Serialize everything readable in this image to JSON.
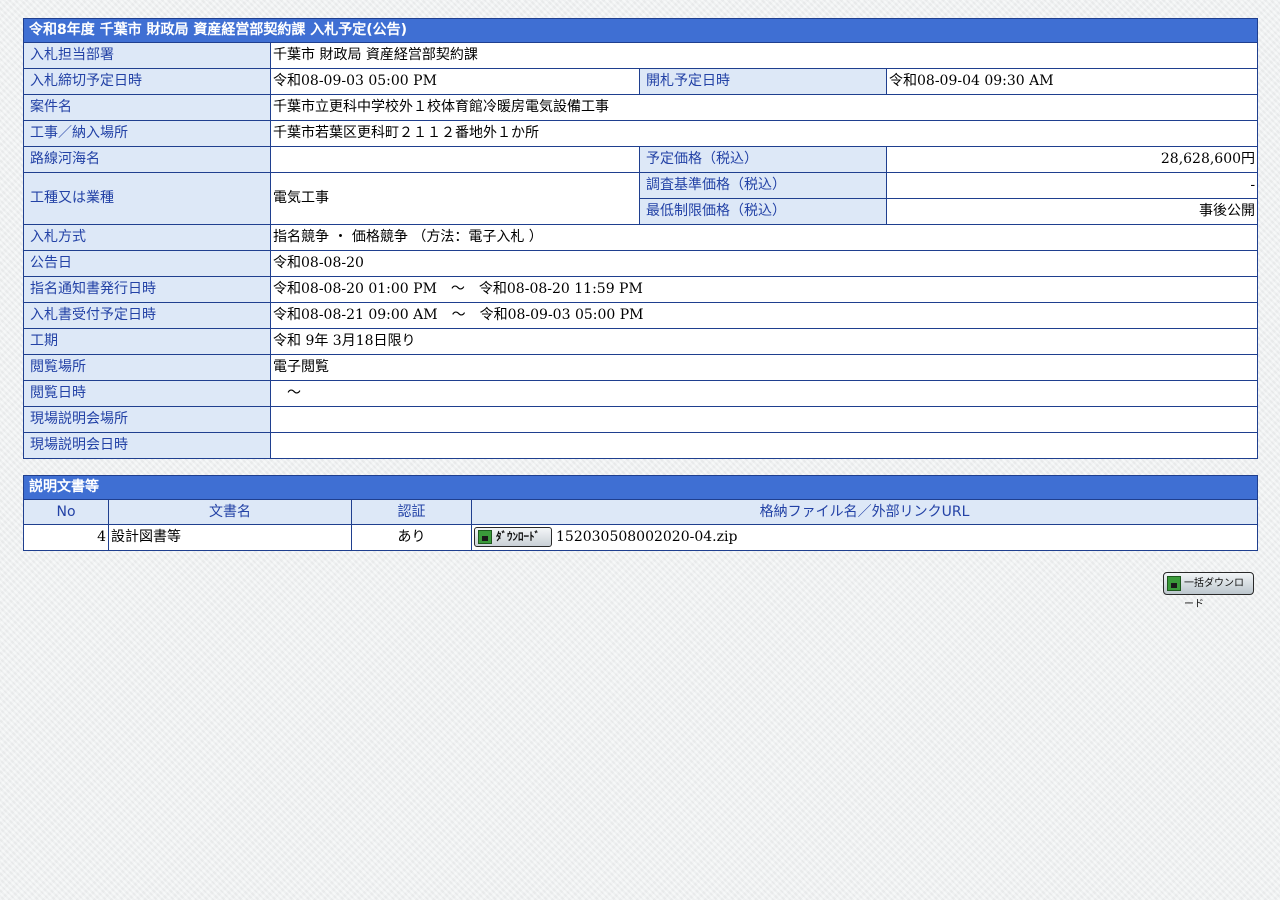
{
  "notice": {
    "title": "令和8年度 千葉市 財政局 資産経営部契約課 入札予定(公告)",
    "rows": {
      "dept": {
        "label": "入札担当部署",
        "value": "千葉市 財政局 資産経営部契約課"
      },
      "deadline": {
        "label": "入札締切予定日時",
        "value": "令和08-09-03 05:00 PM"
      },
      "opening": {
        "label": "開札予定日時",
        "value": "令和08-09-04 09:30 AM"
      },
      "case_name": {
        "label": "案件名",
        "value": "千葉市立更科中学校外１校体育館冷暖房電気設備工事"
      },
      "location": {
        "label": "工事／納入場所",
        "value": "千葉市若葉区更科町２１１２番地外１か所"
      },
      "route": {
        "label": "路線河海名",
        "value": ""
      },
      "planned_price": {
        "label": "予定価格（税込）",
        "value": "28,628,600円"
      },
      "work_type": {
        "label": "工種又は業種",
        "value": "電気工事"
      },
      "survey_price": {
        "label": "調査基準価格（税込）",
        "value": "-"
      },
      "min_price": {
        "label": "最低制限価格（税込）",
        "value": "事後公開"
      },
      "method": {
        "label": "入札方式",
        "value": "指名競争 ・ 価格競争 （方法：電子入札 ）"
      },
      "announce_date": {
        "label": "公告日",
        "value": "令和08-08-20"
      },
      "notify": {
        "label": "指名通知書発行日時",
        "value": "令和08-08-20 01:00 PM　～　令和08-08-20 11:59 PM"
      },
      "reception": {
        "label": "入札書受付予定日時",
        "value": "令和08-08-21 09:00 AM　～　令和08-09-03 05:00 PM"
      },
      "period": {
        "label": "工期",
        "value": "令和 9年 3月18日限り"
      },
      "view_place": {
        "label": "閲覧場所",
        "value": "電子閲覧"
      },
      "view_date": {
        "label": "閲覧日時",
        "value": "　～"
      },
      "briefing_place": {
        "label": "現場説明会場所",
        "value": ""
      },
      "briefing_date": {
        "label": "現場説明会日時",
        "value": ""
      }
    }
  },
  "documents": {
    "title": "説明文書等",
    "headers": {
      "no": "No",
      "name": "文書名",
      "auth": "認証",
      "file": "格納ファイル名／外部リンクURL"
    },
    "rows": [
      {
        "no": "4",
        "name": "設計図書等",
        "auth": "あり",
        "button": "ﾀﾞｳﾝﾛｰﾄﾞ",
        "file": "152030508002020-04.zip"
      }
    ]
  },
  "bulk_download": {
    "label": "一括ダウンロード"
  },
  "icons": [
    "download-icon",
    "bulk-download-icon"
  ],
  "colors": {
    "title_bar": "#3f6fd3",
    "label_bg": "#dde8f7",
    "label_text": "#2342a6",
    "border": "#1f3f8f"
  }
}
